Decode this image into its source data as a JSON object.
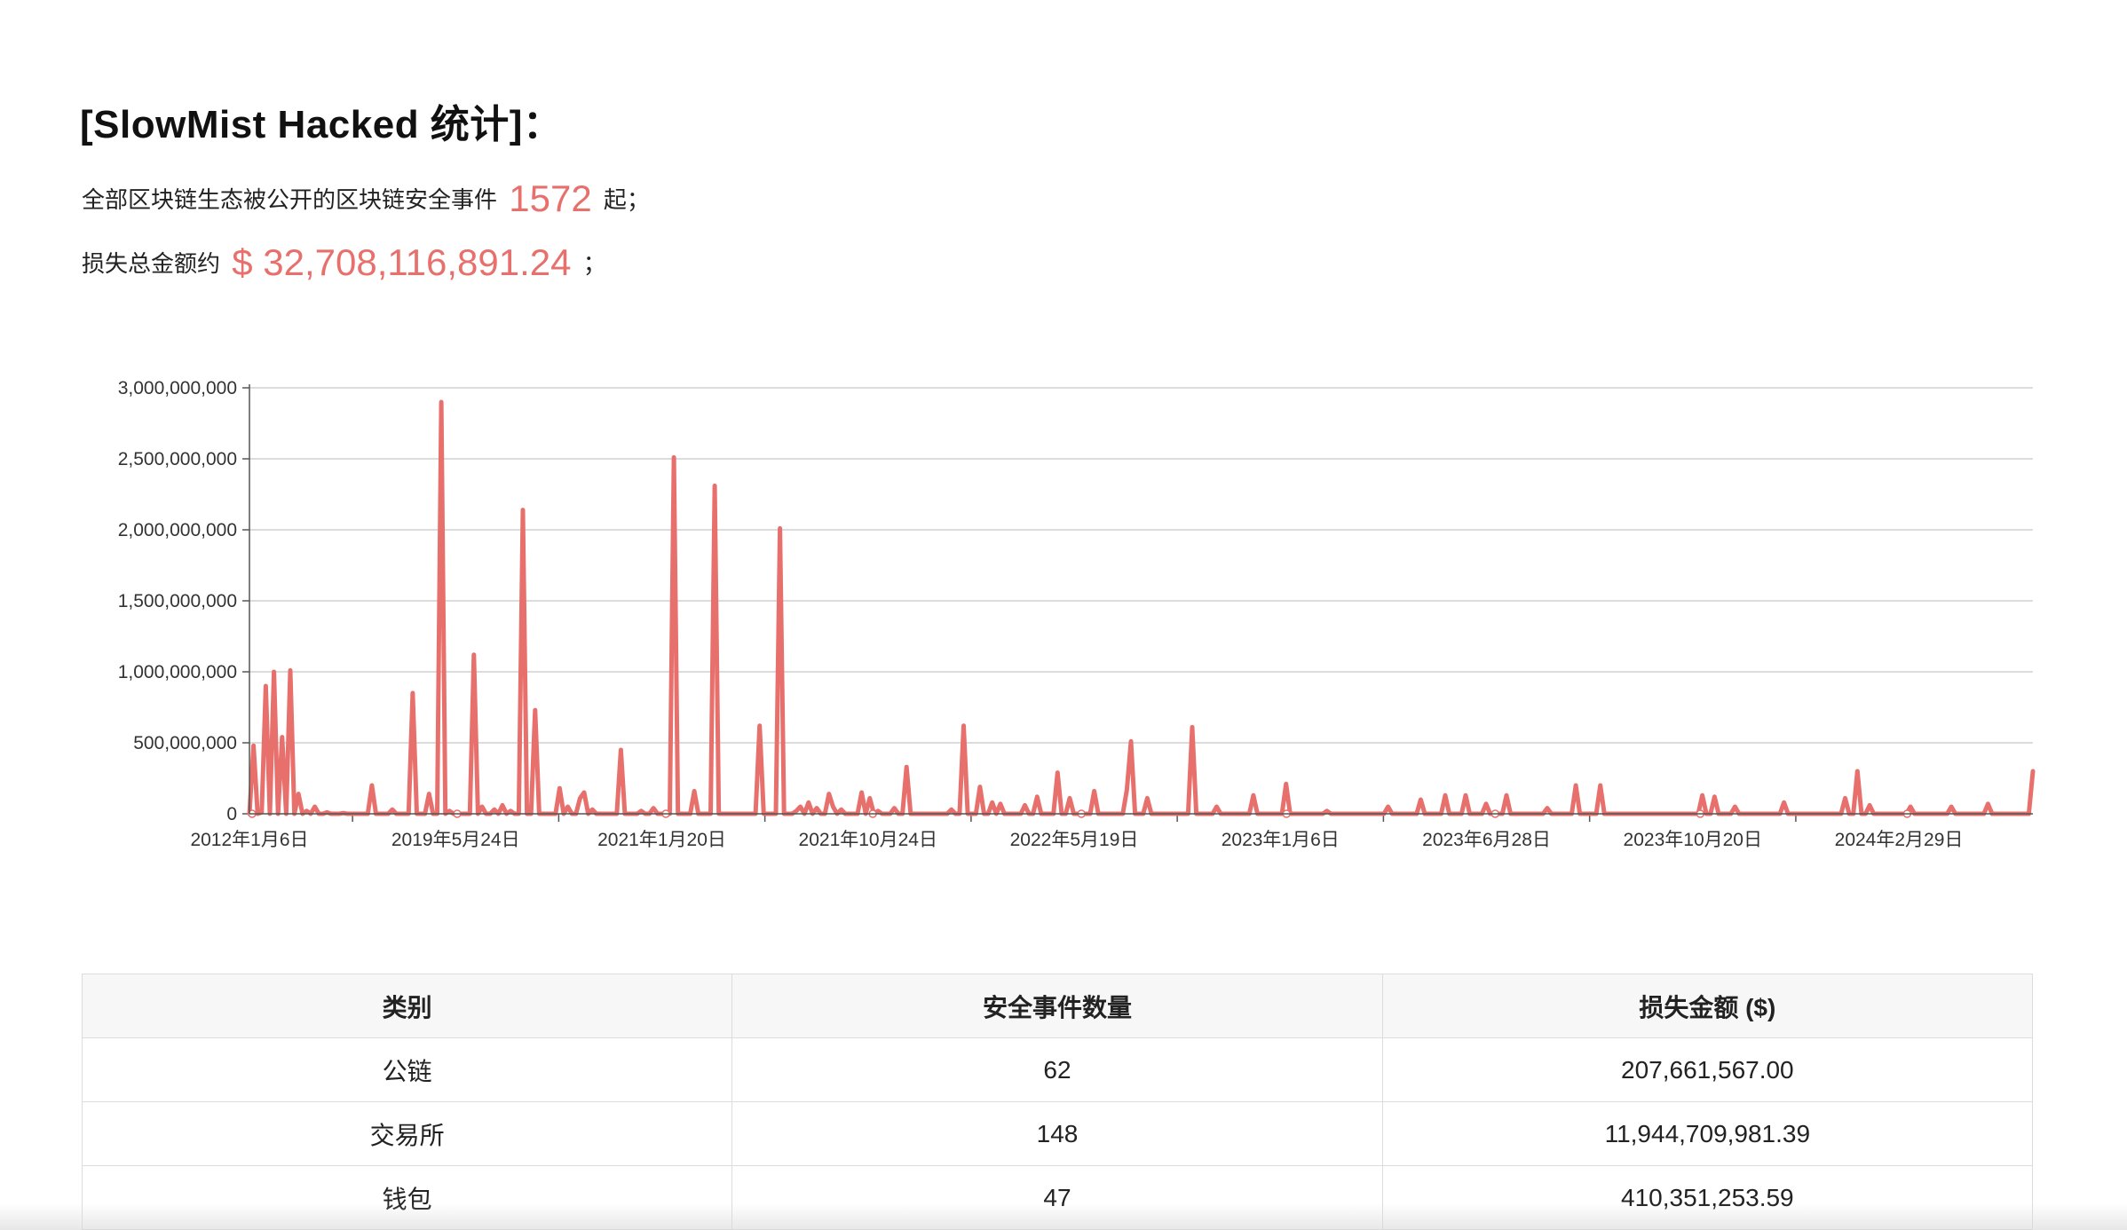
{
  "header": {
    "title": "[SlowMist Hacked 统计]："
  },
  "summary": {
    "line1_prefix": "全部区块链生态被公开的区块链安全事件",
    "event_count": "1572",
    "line1_suffix": "起；",
    "line2_prefix": "损失总金额约",
    "total_loss": "$ 32,708,116,891.24",
    "line2_suffix": "；"
  },
  "colors": {
    "series": "#e7706c",
    "grid": "#d0d0d0",
    "axis": "#555555"
  },
  "chart_data": {
    "type": "line",
    "title": "",
    "xlabel": "",
    "ylabel": "",
    "ylim": [
      0,
      3000000000
    ],
    "yticks": [
      0,
      500000000,
      1000000000,
      1500000000,
      2000000000,
      2500000000,
      3000000000
    ],
    "ytick_labels": [
      "0",
      "500,000,000",
      "1,000,000,000",
      "1,500,000,000",
      "2,000,000,000",
      "2,500,000,000",
      "3,000,000,000"
    ],
    "xtick_labels": [
      "2012年1月6日",
      "2019年5月24日",
      "2021年1月20日",
      "2021年10月24日",
      "2022年5月19日",
      "2023年1月6日",
      "2023年6月28日",
      "2023年10月20日",
      "2024年2月29日"
    ],
    "grid": true,
    "legend": "none",
    "series": [
      {
        "values": [
          0,
          480000000,
          0,
          10000000,
          900000000,
          0,
          1000000000,
          0,
          540000000,
          0,
          1010000000,
          0,
          140000000,
          0,
          20000000,
          0,
          50000000,
          0,
          0,
          10000000,
          0,
          0,
          0,
          5000000,
          0,
          0,
          0,
          0,
          0,
          0,
          200000000,
          0,
          0,
          0,
          0,
          30000000,
          0,
          0,
          0,
          0,
          850000000,
          0,
          0,
          0,
          140000000,
          0,
          0,
          2900000000,
          0,
          20000000,
          0,
          0,
          0,
          0,
          0,
          1120000000,
          0,
          50000000,
          0,
          0,
          30000000,
          0,
          60000000,
          0,
          20000000,
          0,
          0,
          2140000000,
          0,
          0,
          730000000,
          0,
          0,
          0,
          0,
          0,
          180000000,
          0,
          50000000,
          0,
          0,
          110000000,
          150000000,
          0,
          30000000,
          0,
          0,
          0,
          0,
          0,
          0,
          450000000,
          0,
          0,
          0,
          0,
          20000000,
          0,
          0,
          40000000,
          0,
          0,
          0,
          0,
          2510000000,
          0,
          0,
          0,
          0,
          160000000,
          0,
          0,
          0,
          0,
          2310000000,
          0,
          0,
          0,
          0,
          0,
          0,
          0,
          0,
          0,
          0,
          620000000,
          0,
          0,
          0,
          0,
          2010000000,
          0,
          0,
          0,
          20000000,
          50000000,
          0,
          80000000,
          0,
          40000000,
          0,
          0,
          140000000,
          50000000,
          0,
          30000000,
          0,
          0,
          0,
          0,
          150000000,
          0,
          110000000,
          0,
          20000000,
          0,
          0,
          0,
          40000000,
          0,
          0,
          330000000,
          0,
          0,
          0,
          0,
          0,
          0,
          0,
          0,
          0,
          0,
          30000000,
          0,
          0,
          620000000,
          0,
          0,
          0,
          190000000,
          0,
          0,
          80000000,
          0,
          70000000,
          0,
          0,
          0,
          0,
          0,
          60000000,
          0,
          0,
          120000000,
          0,
          0,
          0,
          0,
          290000000,
          0,
          0,
          110000000,
          0,
          0,
          0,
          0,
          0,
          160000000,
          0,
          0,
          0,
          0,
          0,
          0,
          0,
          170000000,
          510000000,
          0,
          0,
          0,
          110000000,
          0,
          0,
          0,
          0,
          0,
          0,
          0,
          0,
          0,
          0,
          610000000,
          0,
          0,
          0,
          0,
          0,
          50000000,
          0,
          0,
          0,
          0,
          0,
          0,
          0,
          0,
          130000000,
          0,
          0,
          0,
          0,
          0,
          0,
          0,
          210000000,
          0,
          0,
          0,
          0,
          0,
          0,
          0,
          0,
          0,
          20000000,
          0,
          0,
          0,
          0,
          0,
          0,
          0,
          0,
          0,
          0,
          0,
          0,
          0,
          0,
          50000000,
          0,
          0,
          0,
          0,
          0,
          0,
          0,
          100000000,
          0,
          0,
          0,
          0,
          0,
          130000000,
          0,
          0,
          0,
          0,
          130000000,
          0,
          0,
          0,
          0,
          70000000,
          0,
          0,
          0,
          0,
          130000000,
          0,
          0,
          0,
          0,
          0,
          0,
          0,
          0,
          0,
          40000000,
          0,
          0,
          0,
          0,
          0,
          0,
          200000000,
          0,
          0,
          0,
          0,
          0,
          200000000,
          0,
          0,
          0,
          0,
          0,
          0,
          0,
          0,
          0,
          0,
          0,
          0,
          0,
          0,
          0,
          0,
          0,
          0,
          0,
          0,
          0,
          0,
          0,
          0,
          130000000,
          0,
          0,
          120000000,
          0,
          0,
          0,
          0,
          50000000,
          0,
          0,
          0,
          0,
          0,
          0,
          0,
          0,
          0,
          0,
          0,
          80000000,
          0,
          0,
          0,
          0,
          0,
          0,
          0,
          0,
          0,
          0,
          0,
          0,
          0,
          0,
          110000000,
          0,
          0,
          300000000,
          0,
          0,
          60000000,
          0,
          0,
          0,
          0,
          0,
          0,
          0,
          0,
          0,
          50000000,
          0,
          0,
          0,
          0,
          0,
          0,
          0,
          0,
          0,
          50000000,
          0,
          0,
          0,
          0,
          0,
          0,
          0,
          0,
          70000000,
          0,
          0,
          0,
          0,
          0,
          0,
          0,
          0,
          0,
          0,
          300000000
        ]
      }
    ]
  },
  "table": {
    "headers": [
      "类别",
      "安全事件数量",
      "损失金额 ($)"
    ],
    "rows": [
      [
        "公链",
        "62",
        "207,661,567.00"
      ],
      [
        "交易所",
        "148",
        "11,944,709,981.39"
      ],
      [
        "钱包",
        "47",
        "410,351,253.59"
      ]
    ]
  }
}
